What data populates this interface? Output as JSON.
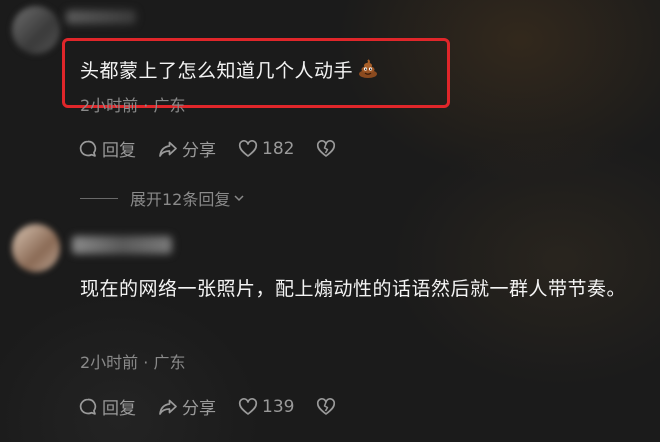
{
  "comments": [
    {
      "text": "头都蒙上了怎么知道几个人动手",
      "emoji": "poop-emoji",
      "meta": "2小时前 · 广东",
      "reply_label": "回复",
      "share_label": "分享",
      "likes": "182",
      "replies_expand": "展开12条回复"
    },
    {
      "text": "现在的网络一张照片，配上煽动性的话语然后就一群人带节奏。",
      "meta": "2小时前 · 广东",
      "reply_label": "回复",
      "share_label": "分享",
      "likes": "139"
    }
  ],
  "colors": {
    "highlight": "#e0262a",
    "background": "#1b1b1b",
    "meta_text": "#8a8a8a"
  }
}
